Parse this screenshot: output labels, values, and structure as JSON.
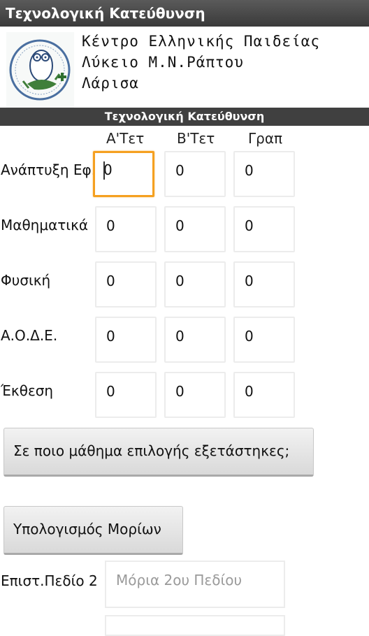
{
  "app": {
    "title": "Τεχνολογική Κατεύθυνση"
  },
  "header": {
    "school_line1": "Κέντρο Ελληνικής Παιδείας",
    "school_line2": "Λύκειο Μ.Ν.Ράπτου",
    "school_line3": "Λάρισα",
    "logo_icon": "owl-logo-icon"
  },
  "section": {
    "title": "Τεχνολογική Κατεύθυνση"
  },
  "columns": [
    "Α'Τετ",
    "Β'Τετ",
    "Γραπ"
  ],
  "rows": [
    {
      "label": "Ανάπτυξη Εφ.",
      "values": [
        "0",
        "0",
        "0"
      ]
    },
    {
      "label": "Μαθηματικά",
      "values": [
        "0",
        "0",
        "0"
      ]
    },
    {
      "label": "Φυσική",
      "values": [
        "0",
        "0",
        "0"
      ]
    },
    {
      "label": "Α.Ο.Δ.Ε.",
      "values": [
        "0",
        "0",
        "0"
      ]
    },
    {
      "label": "Έκθεση",
      "values": [
        "0",
        "0",
        "0"
      ]
    }
  ],
  "buttons": {
    "elective": "Σε ποιο μάθημα επιλογής εξετάστηκες;",
    "calculate": "Υπολογισμός Μορίων"
  },
  "fields": {
    "field2_label": "Επιστ.Πεδίο 2",
    "field2_placeholder": "Μόρια 2ου Πεδίου"
  },
  "colors": {
    "focus": "#f5a020",
    "titlebar": "#404040"
  }
}
